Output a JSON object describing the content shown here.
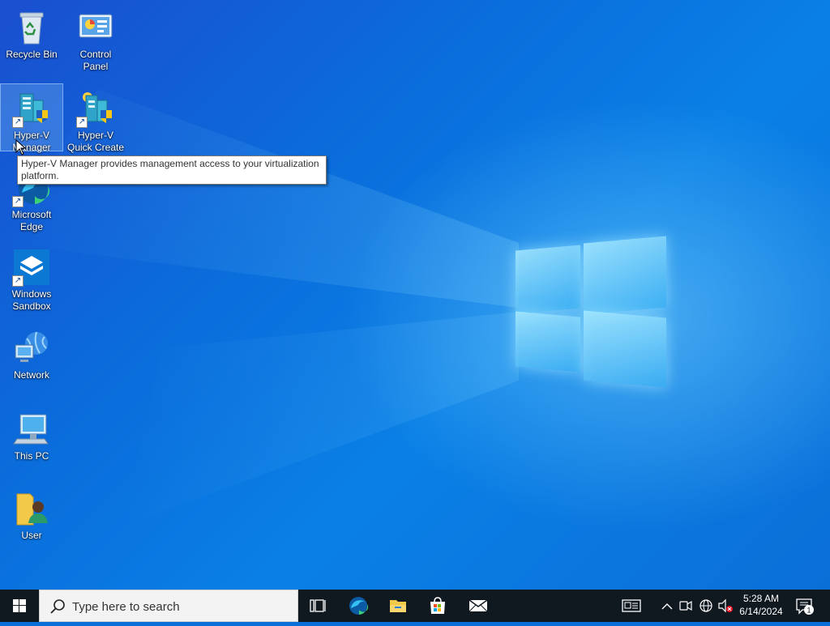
{
  "desktop": {
    "icons": [
      {
        "label": "Recycle Bin"
      },
      {
        "label": "Control Panel"
      },
      {
        "label_line1": "Hyper-V",
        "label_line2": "Manager"
      },
      {
        "label_line1": "Hyper-V",
        "label_line2": "Quick Create"
      },
      {
        "label_line1": "Microsoft",
        "label_line2": "Edge"
      },
      {
        "label_line1": "Windows",
        "label_line2": "Sandbox"
      },
      {
        "label": "Network"
      },
      {
        "label": "This PC"
      },
      {
        "label": "User"
      }
    ],
    "tooltip": "Hyper-V Manager provides management access to your virtualization platform."
  },
  "taskbar": {
    "search_placeholder": "Type here to search",
    "apps": [
      "task-view",
      "microsoft-edge",
      "file-explorer",
      "microsoft-store",
      "mail"
    ],
    "clock": {
      "time": "5:28 AM",
      "date": "6/14/2024"
    },
    "notification_count": "1"
  },
  "colors": {
    "taskbar": "#101820",
    "wallpaper_primary": "#0a6fd8",
    "accent": "#0078d7"
  }
}
